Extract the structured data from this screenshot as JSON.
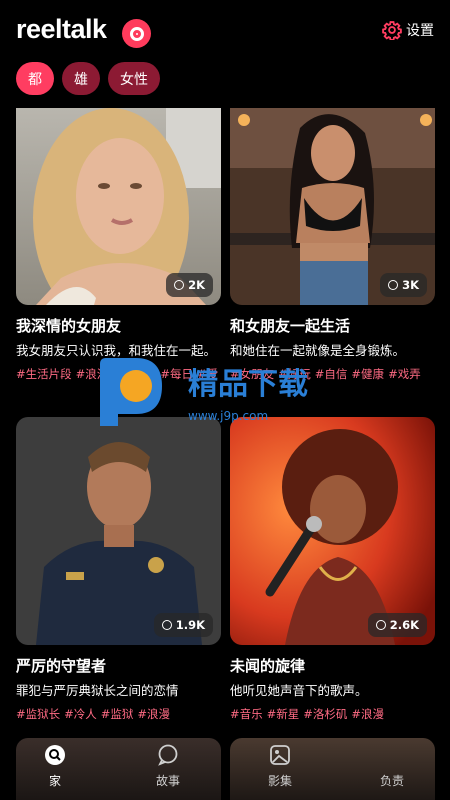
{
  "app": {
    "name": "reeltalk"
  },
  "header": {
    "settings_label": "设置"
  },
  "filters": [
    {
      "label": "都",
      "active": true
    },
    {
      "label": "雄",
      "active": false
    },
    {
      "label": "女性",
      "active": false
    }
  ],
  "cards": [
    {
      "title": "我深情的女朋友",
      "desc": "我女朋友只认识我，和我住在一起。",
      "count": "2K",
      "tags": [
        "#生活片段",
        "#浪漫",
        "#女朋友",
        "#每日",
        "#爱"
      ]
    },
    {
      "title": "和女朋友一起生活",
      "desc": "和她住在一起就像是全身锻炼。",
      "count": "3K",
      "tags": [
        "#女朋友",
        "#好玩",
        "#自信",
        "#健康",
        "#戏弄"
      ]
    },
    {
      "title": "严厉的守望者",
      "desc": "罪犯与严厉典狱长之间的恋情",
      "count": "1.9K",
      "tags": [
        "#监狱长",
        "#冷人",
        "#监狱",
        "#浪漫"
      ]
    },
    {
      "title": "未闻的旋律",
      "desc": "他听见她声音下的歌声。",
      "count": "2.6K",
      "tags": [
        "#音乐",
        "#新星",
        "#洛杉矶",
        "#浪漫"
      ]
    }
  ],
  "watermark": {
    "text": "精品下载",
    "url": "www.j9p.com"
  },
  "tabbar": [
    {
      "label": "家",
      "icon": "search-icon",
      "active": true
    },
    {
      "label": "故事",
      "icon": "chat-bubble-icon",
      "active": false
    },
    {
      "label": "影集",
      "icon": "image-icon",
      "active": false
    },
    {
      "label": "负责",
      "icon": "profile-icon",
      "active": false
    }
  ],
  "colors": {
    "accent": "#ff3d61",
    "chip_inactive": "#8c1a33",
    "tag": "#ff6b84",
    "background": "#000000"
  }
}
